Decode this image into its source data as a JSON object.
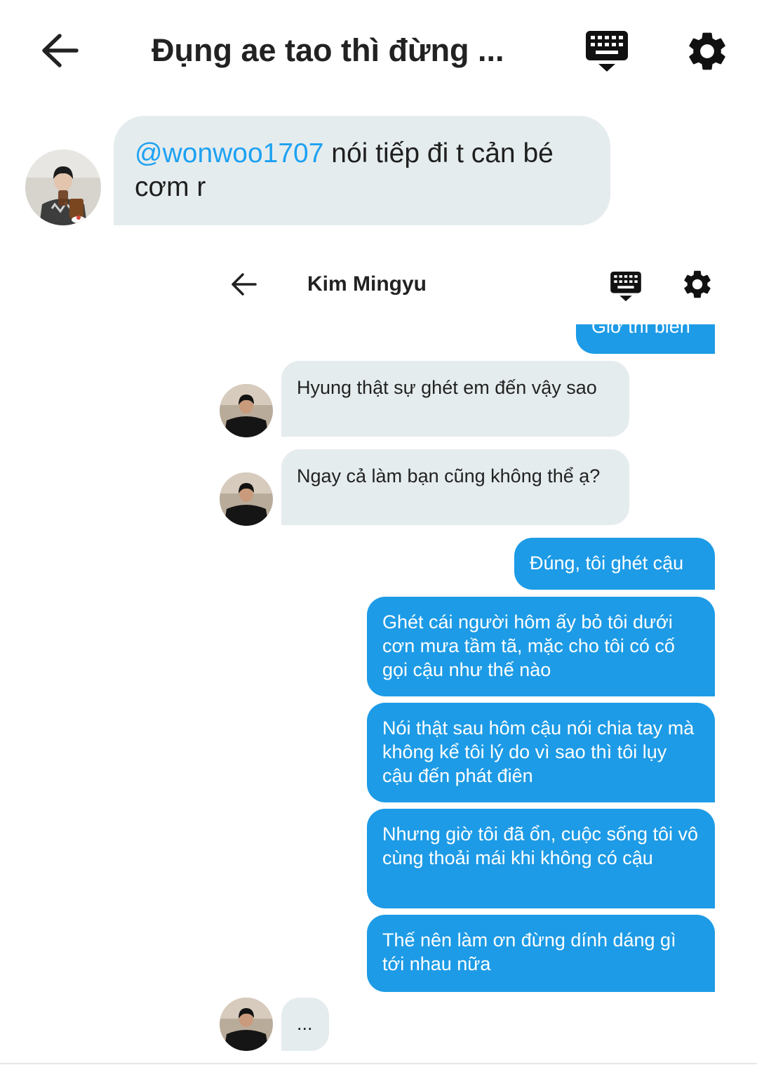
{
  "header": {
    "title": "Đụng ae tao thì đừng ...",
    "back_icon": "arrow-left-icon",
    "keyboard_icon": "keyboard-icon",
    "settings_icon": "gear-icon"
  },
  "outer_message": {
    "mention": "@wonwoo1707",
    "text": " nói tiếp đi t cản bé cơm r"
  },
  "embedded": {
    "title": "Kim Mingyu",
    "messages": [
      {
        "side": "sent",
        "text": "Giờ thì biến"
      },
      {
        "side": "received",
        "text": "Hyung thật sự ghét em đến vậy sao"
      },
      {
        "side": "received",
        "text": "Ngay cả làm bạn cũng không thể ạ?"
      },
      {
        "side": "sent",
        "text": "Đúng, tôi ghét cậu"
      },
      {
        "side": "sent",
        "text": "Ghét cái người hôm ấy bỏ tôi dưới cơn mưa tầm tã, mặc cho tôi có cố gọi cậu như thế nào"
      },
      {
        "side": "sent",
        "text": "Nói thật sau hôm cậu nói chia tay mà không kể tôi lý do vì sao thì tôi lụy cậu đến phát điên"
      },
      {
        "side": "sent",
        "text": "Nhưng giờ tôi đã ổn, cuộc sống tôi vô cùng thoải mái khi không có cậu"
      },
      {
        "side": "sent",
        "text": "Thế nên làm ơn đừng dính dáng gì tới nhau nữa"
      },
      {
        "side": "received",
        "text": "..."
      }
    ]
  },
  "colors": {
    "sent_bubble": "#1d9be6",
    "received_bubble": "#e5ecee",
    "mention": "#1da1f2"
  }
}
